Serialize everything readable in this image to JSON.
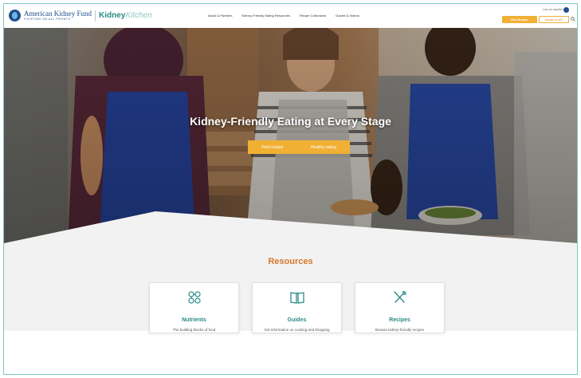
{
  "header": {
    "logo_akf": "American Kidney Fund",
    "logo_tagline": "FIGHTING ON ALL FRONTS",
    "logo_kitchen_bold": "Kidney",
    "logo_kitchen_light": "Kitchen",
    "nav": [
      "About & Partners",
      "Kidney-Friendly Eating Resources",
      "Recipe Collections",
      "Guides & Videos"
    ],
    "language": "Leer en español",
    "find_recipes": "Find Recipes",
    "donate": "Donate to AKF"
  },
  "hero": {
    "title": "Kidney-Friendly Eating at Every Stage",
    "buttons": [
      "Find recipes",
      "Healthy eating"
    ]
  },
  "resources": {
    "title": "Resources",
    "cards": [
      {
        "icon": "nutrients-icon",
        "title": "Nutrients",
        "desc": "The building blocks of food"
      },
      {
        "icon": "guides-book-icon",
        "title": "Guides",
        "desc": "Get information on cooking and shopping"
      },
      {
        "icon": "recipes-utensils-icon",
        "title": "Recipes",
        "desc": "Browse kidney-friendly recipes"
      }
    ]
  },
  "colors": {
    "teal": "#2a8c86",
    "orange": "#d5792c",
    "yellow": "#f1b034",
    "navy": "#1f4e8c"
  }
}
